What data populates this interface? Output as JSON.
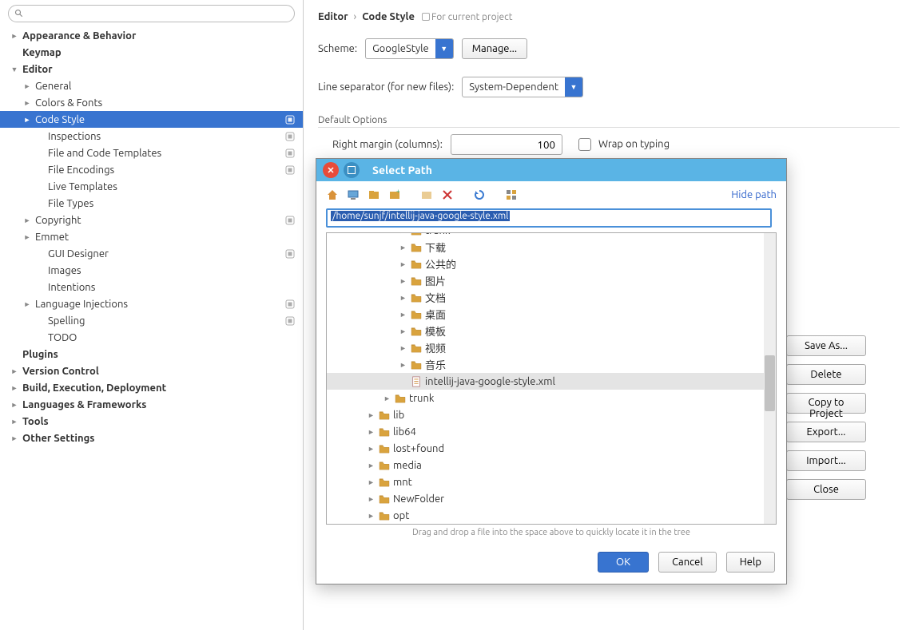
{
  "breadcrumb": {
    "a": "Editor",
    "b": "Code Style",
    "hint": "For current project"
  },
  "scheme": {
    "label": "Scheme:",
    "value": "GoogleStyle",
    "manage": "Manage..."
  },
  "lineSep": {
    "label": "Line separator (for new files):",
    "value": "System-Dependent"
  },
  "defaultOptions": {
    "title": "Default Options",
    "rightMarginLabel": "Right margin (columns):",
    "rightMarginValue": "100",
    "wrapLabel": "Wrap on typing"
  },
  "sideButtons": {
    "saveAs": "Save As...",
    "delete": "Delete",
    "copyTo": "Copy to Project",
    "export": "Export...",
    "import": "Import...",
    "close": "Close"
  },
  "modal": {
    "title": "Select Path",
    "hidePath": "Hide path",
    "pathValue": "/home/sunjf/intellij-java-google-style.xml",
    "hint": "Drag and drop a file into the space above to quickly locate it in the tree",
    "ok": "OK",
    "cancel": "Cancel",
    "help": "Help"
  },
  "sidebar": [
    {
      "label": "Appearance & Behavior",
      "bold": true,
      "twisty": "►",
      "indent": 0
    },
    {
      "label": "Keymap",
      "bold": true,
      "indent": 0
    },
    {
      "label": "Editor",
      "bold": true,
      "twisty": "▼",
      "indent": 0
    },
    {
      "label": "General",
      "twisty": "►",
      "indent": 1
    },
    {
      "label": "Colors & Fonts",
      "twisty": "►",
      "indent": 1
    },
    {
      "label": "Code Style",
      "twisty": "►",
      "indent": 1,
      "selected": true,
      "badge": true
    },
    {
      "label": "Inspections",
      "indent": 2,
      "badge": true
    },
    {
      "label": "File and Code Templates",
      "indent": 2,
      "badge": true
    },
    {
      "label": "File Encodings",
      "indent": 2,
      "badge": true
    },
    {
      "label": "Live Templates",
      "indent": 2
    },
    {
      "label": "File Types",
      "indent": 2
    },
    {
      "label": "Copyright",
      "twisty": "►",
      "indent": 1,
      "badge": true
    },
    {
      "label": "Emmet",
      "twisty": "►",
      "indent": 1
    },
    {
      "label": "GUI Designer",
      "indent": 2,
      "badge": true
    },
    {
      "label": "Images",
      "indent": 2
    },
    {
      "label": "Intentions",
      "indent": 2
    },
    {
      "label": "Language Injections",
      "twisty": "►",
      "indent": 1,
      "badge": true
    },
    {
      "label": "Spelling",
      "indent": 2,
      "badge": true
    },
    {
      "label": "TODO",
      "indent": 2
    },
    {
      "label": "Plugins",
      "bold": true,
      "indent": 0
    },
    {
      "label": "Version Control",
      "bold": true,
      "twisty": "►",
      "indent": 0
    },
    {
      "label": "Build, Execution, Deployment",
      "bold": true,
      "twisty": "►",
      "indent": 0
    },
    {
      "label": "Languages & Frameworks",
      "bold": true,
      "twisty": "►",
      "indent": 0
    },
    {
      "label": "Tools",
      "bold": true,
      "twisty": "►",
      "indent": 0
    },
    {
      "label": "Other Settings",
      "bold": true,
      "twisty": "►",
      "indent": 0
    }
  ],
  "fileTree": [
    {
      "name": "trunk",
      "indent": 4,
      "twisty": "►",
      "folder": true,
      "clipped": true
    },
    {
      "name": "下载",
      "indent": 4,
      "twisty": "►",
      "folder": true
    },
    {
      "name": "公共的",
      "indent": 4,
      "twisty": "►",
      "folder": true
    },
    {
      "name": "图片",
      "indent": 4,
      "twisty": "►",
      "folder": true
    },
    {
      "name": "文档",
      "indent": 4,
      "twisty": "►",
      "folder": true
    },
    {
      "name": "桌面",
      "indent": 4,
      "twisty": "►",
      "folder": true
    },
    {
      "name": "模板",
      "indent": 4,
      "twisty": "►",
      "folder": true
    },
    {
      "name": "视频",
      "indent": 4,
      "twisty": "►",
      "folder": true
    },
    {
      "name": "音乐",
      "indent": 4,
      "twisty": "►",
      "folder": true
    },
    {
      "name": "intellij-java-google-style.xml",
      "indent": 4,
      "file": true,
      "selected": true
    },
    {
      "name": "trunk",
      "indent": 3,
      "twisty": "►",
      "folder": true
    },
    {
      "name": "lib",
      "indent": 2,
      "twisty": "►",
      "folder": true
    },
    {
      "name": "lib64",
      "indent": 2,
      "twisty": "►",
      "folder": true
    },
    {
      "name": "lost+found",
      "indent": 2,
      "twisty": "►",
      "folder": true
    },
    {
      "name": "media",
      "indent": 2,
      "twisty": "►",
      "folder": true
    },
    {
      "name": "mnt",
      "indent": 2,
      "twisty": "►",
      "folder": true
    },
    {
      "name": "NewFolder",
      "indent": 2,
      "twisty": "►",
      "folder": true
    },
    {
      "name": "opt",
      "indent": 2,
      "twisty": "►",
      "folder": true
    }
  ]
}
